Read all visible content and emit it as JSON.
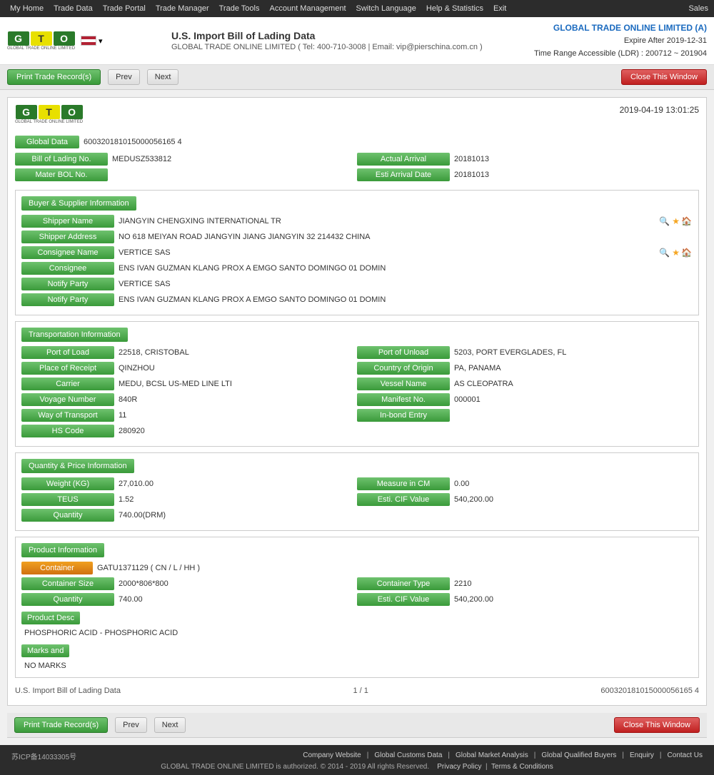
{
  "topnav": {
    "items": [
      "My Home",
      "Trade Data",
      "Trade Portal",
      "Trade Manager",
      "Trade Tools",
      "Account Management",
      "Switch Language",
      "Help & Statistics",
      "Exit",
      "Sales"
    ]
  },
  "header": {
    "title": "U.S. Import Bill of Lading Data",
    "subtitle": "GLOBAL TRADE ONLINE LIMITED ( Tel: 400-710-3008 | Email: vip@pierschina.com.cn )",
    "company": "GLOBAL TRADE ONLINE LIMITED (A)",
    "expire": "Expire After 2019-12-31",
    "timerange": "Time Range Accessible (LDR) : 200712 ~ 201904"
  },
  "toolbar": {
    "print_label": "Print Trade Record(s)",
    "prev_label": "Prev",
    "next_label": "Next",
    "close_label": "Close This Window"
  },
  "record": {
    "datetime": "2019-04-19  13:01:25",
    "global_data_label": "Global Data",
    "global_data_value": "600320181015000056165 4",
    "bill_of_lading_no_label": "Bill of Lading No.",
    "bill_of_lading_no_value": "MEDUSZ533812",
    "actual_arrival_label": "Actual Arrival",
    "actual_arrival_value": "20181013",
    "mater_bol_label": "Mater BOL No.",
    "mater_bol_value": "",
    "esti_arrival_label": "Esti Arrival Date",
    "esti_arrival_value": "20181013"
  },
  "buyer_supplier": {
    "section_title": "Buyer & Supplier Information",
    "shipper_name_label": "Shipper Name",
    "shipper_name_value": "JIANGYIN CHENGXING INTERNATIONAL TR",
    "shipper_address_label": "Shipper Address",
    "shipper_address_value": "NO 618 MEIYAN ROAD JIANGYIN JIANG JIANGYIN 32 214432 CHINA",
    "consignee_name_label": "Consignee Name",
    "consignee_name_value": "VERTICE SAS",
    "consignee_label": "Consignee",
    "consignee_value": "ENS IVAN GUZMAN KLANG PROX A EMGO SANTO DOMINGO 01 DOMIN",
    "notify_party_label": "Notify Party",
    "notify_party_value1": "VERTICE SAS",
    "notify_party_value2": "ENS IVAN GUZMAN KLANG PROX A EMGO SANTO DOMINGO 01 DOMIN"
  },
  "transportation": {
    "section_title": "Transportation Information",
    "port_of_load_label": "Port of Load",
    "port_of_load_value": "22518, CRISTOBAL",
    "port_of_unload_label": "Port of Unload",
    "port_of_unload_value": "5203, PORT EVERGLADES, FL",
    "place_of_receipt_label": "Place of Receipt",
    "place_of_receipt_value": "QINZHOU",
    "country_of_origin_label": "Country of Origin",
    "country_of_origin_value": "PA, PANAMA",
    "carrier_label": "Carrier",
    "carrier_value": "MEDU, BCSL US-MED LINE LTI",
    "vessel_name_label": "Vessel Name",
    "vessel_name_value": "AS CLEOPATRA",
    "voyage_number_label": "Voyage Number",
    "voyage_number_value": "840R",
    "manifest_no_label": "Manifest No.",
    "manifest_no_value": "000001",
    "way_of_transport_label": "Way of Transport",
    "way_of_transport_value": "11",
    "in_bond_entry_label": "In-bond Entry",
    "in_bond_entry_value": "",
    "hs_code_label": "HS Code",
    "hs_code_value": "280920"
  },
  "quantity_price": {
    "section_title": "Quantity & Price Information",
    "weight_kg_label": "Weight (KG)",
    "weight_kg_value": "27,010.00",
    "measure_in_cm_label": "Measure in CM",
    "measure_in_cm_value": "0.00",
    "teus_label": "TEUS",
    "teus_value": "1.52",
    "esti_cif_value_label": "Esti. CIF Value",
    "esti_cif_value": "540,200.00",
    "quantity_label": "Quantity",
    "quantity_value": "740.00(DRM)"
  },
  "product_info": {
    "section_title": "Product Information",
    "container_label": "Container",
    "container_value": "GATU1371129 ( CN / L / HH )",
    "container_size_label": "Container Size",
    "container_size_value": "2000*806*800",
    "container_type_label": "Container Type",
    "container_type_value": "2210",
    "quantity_label": "Quantity",
    "quantity_value": "740.00",
    "esti_cif_label": "Esti. CIF Value",
    "esti_cif_value": "540,200.00",
    "product_desc_header": "Product Desc",
    "product_desc_value": "PHOSPHORIC ACID - PHOSPHORIC ACID",
    "marks_header": "Marks and",
    "marks_value": "NO MARKS"
  },
  "page_footer": {
    "data_source": "U.S. Import Bill of Lading Data",
    "page_info": "1 / 1",
    "record_id": "600320181015000056165 4"
  },
  "bottom_footer": {
    "icp": "苏ICP备14033305号",
    "links": [
      "Company Website",
      "Global Customs Data",
      "Global Market Analysis",
      "Global Qualified Buyers",
      "Enquiry",
      "Contact Us"
    ],
    "copyright": "GLOBAL TRADE ONLINE LIMITED is authorized. © 2014 - 2019 All rights Reserved.",
    "privacy": "Privacy Policy",
    "terms": "Terms & Conditions"
  }
}
